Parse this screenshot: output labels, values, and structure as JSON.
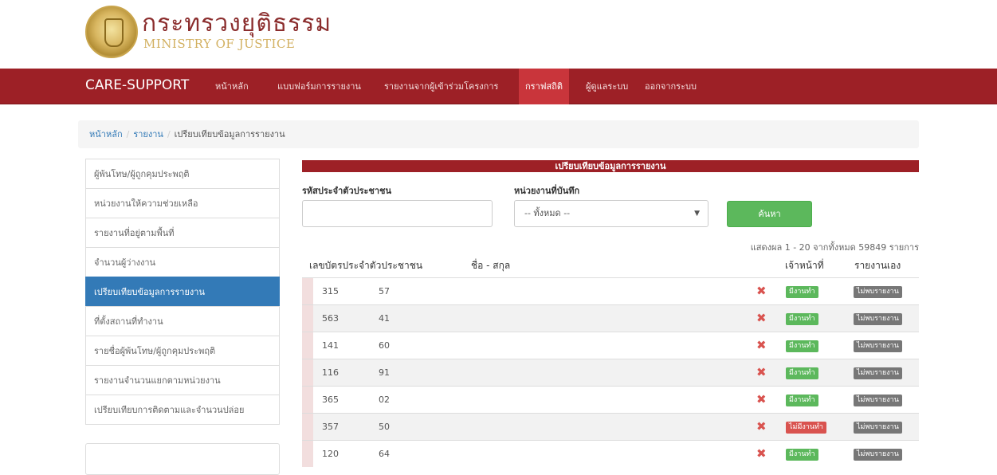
{
  "header": {
    "brand_th": "กระทรวงยุติธรรม",
    "brand_en": "MINISTRY OF JUSTICE"
  },
  "navbar": {
    "brand": "CARE-SUPPORT",
    "items": [
      {
        "label": "หน้าหลัก"
      },
      {
        "label": "แบบฟอร์มการรายงาน"
      },
      {
        "label": "รายงานจากผู้เข้าร่วมโครงการ"
      },
      {
        "label": "กราฟสถิติ"
      },
      {
        "label": "ผู้ดูแลระบบ"
      },
      {
        "label": "ออกจากระบบ"
      }
    ],
    "colors": {
      "bar": "#9d2026",
      "active": "#c9353b"
    }
  },
  "breadcrumb": {
    "home": "หน้าหลัก",
    "report": "รายงาน",
    "current": "เปรียบเทียบข้อมูลการรายงาน"
  },
  "sidebar": {
    "items": [
      {
        "label": "ผู้พ้นโทษ/ผู้ถูกคุมประพฤติ"
      },
      {
        "label": "หน่วยงานให้ความช่วยเหลือ"
      },
      {
        "label": "รายงานที่อยู่ตามพื้นที่"
      },
      {
        "label": "จำนวนผู้ว่างงาน"
      },
      {
        "label": "เปรียบเทียบข้อมูลการรายงาน"
      },
      {
        "label": "ที่ตั้งสถานที่ทำงาน"
      },
      {
        "label": "รายชื่อผู้พ้นโทษ/ผู้ถูกคุมประพฤติ"
      },
      {
        "label": "รายงานจำนวนแยกตามหน่วยงาน"
      },
      {
        "label": "เปรียบเทียบการติดตามและจำนวนปล่อย"
      }
    ]
  },
  "panel": {
    "title": "เปรียบเทียบข้อมูลการรายงาน",
    "id_label": "รหัสประจำตัวประชาชน",
    "unit_label": "หน่วยงานที่บันทึก",
    "unit_selected": "-- ทั้งหมด --",
    "search_button": "ค้นหา",
    "summary": "แสดงผล 1 - 20 จากทั้งหมด 59849 รายการ"
  },
  "table": {
    "headers": {
      "id": "เลขบัตรประจำตัวประชาชน",
      "name": "ชื่อ - สกุล",
      "officer": "เจ้าหน้าที่",
      "self": "รายงานเอง"
    },
    "rows": [
      {
        "id_a": "315",
        "id_b": "57",
        "officer": "มีงานทำ",
        "officer_status": "green",
        "self": "ไม่พบรายงาน"
      },
      {
        "id_a": "563",
        "id_b": "41",
        "officer": "มีงานทำ",
        "officer_status": "green",
        "self": "ไม่พบรายงาน"
      },
      {
        "id_a": "141",
        "id_b": "60",
        "officer": "มีงานทำ",
        "officer_status": "green",
        "self": "ไม่พบรายงาน"
      },
      {
        "id_a": "116",
        "id_b": "91",
        "officer": "มีงานทำ",
        "officer_status": "green",
        "self": "ไม่พบรายงาน"
      },
      {
        "id_a": "365",
        "id_b": "02",
        "officer": "มีงานทำ",
        "officer_status": "green",
        "self": "ไม่พบรายงาน"
      },
      {
        "id_a": "357",
        "id_b": "50",
        "officer": "ไม่มีงานทำ",
        "officer_status": "red",
        "self": "ไม่พบรายงาน"
      },
      {
        "id_a": "120",
        "id_b": "64",
        "officer": "มีงานทำ",
        "officer_status": "green",
        "self": "ไม่พบรายงาน"
      }
    ]
  }
}
